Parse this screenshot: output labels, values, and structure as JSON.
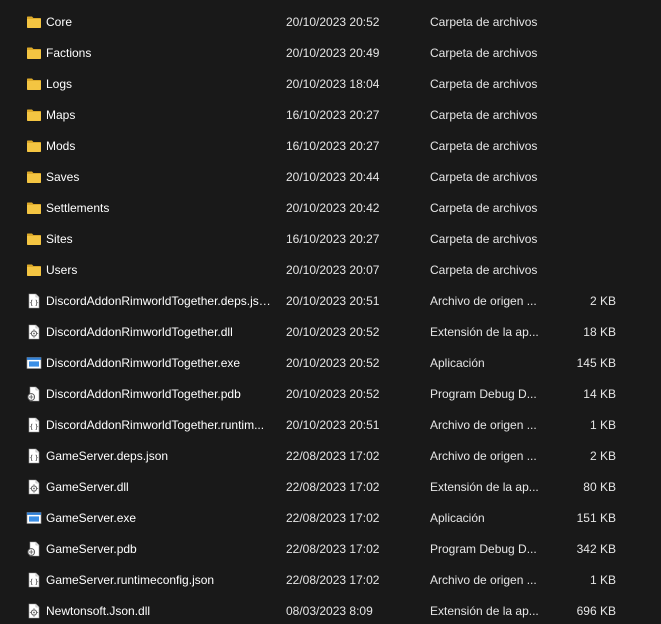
{
  "files": [
    {
      "name": "Core",
      "date": "20/10/2023 20:52",
      "type": "Carpeta de archivos",
      "size": "",
      "icon": "folder-icon"
    },
    {
      "name": "Factions",
      "date": "20/10/2023 20:49",
      "type": "Carpeta de archivos",
      "size": "",
      "icon": "folder-icon"
    },
    {
      "name": "Logs",
      "date": "20/10/2023 18:04",
      "type": "Carpeta de archivos",
      "size": "",
      "icon": "folder-icon"
    },
    {
      "name": "Maps",
      "date": "16/10/2023 20:27",
      "type": "Carpeta de archivos",
      "size": "",
      "icon": "folder-icon"
    },
    {
      "name": "Mods",
      "date": "16/10/2023 20:27",
      "type": "Carpeta de archivos",
      "size": "",
      "icon": "folder-icon"
    },
    {
      "name": "Saves",
      "date": "20/10/2023 20:44",
      "type": "Carpeta de archivos",
      "size": "",
      "icon": "folder-icon"
    },
    {
      "name": "Settlements",
      "date": "20/10/2023 20:42",
      "type": "Carpeta de archivos",
      "size": "",
      "icon": "folder-icon"
    },
    {
      "name": "Sites",
      "date": "16/10/2023 20:27",
      "type": "Carpeta de archivos",
      "size": "",
      "icon": "folder-icon"
    },
    {
      "name": "Users",
      "date": "20/10/2023 20:07",
      "type": "Carpeta de archivos",
      "size": "",
      "icon": "folder-icon"
    },
    {
      "name": "DiscordAddonRimworldTogether.deps.json",
      "date": "20/10/2023 20:51",
      "type": "Archivo de origen ...",
      "size": "2 KB",
      "icon": "json-file-icon"
    },
    {
      "name": "DiscordAddonRimworldTogether.dll",
      "date": "20/10/2023 20:52",
      "type": "Extensión de la ap...",
      "size": "18 KB",
      "icon": "dll-file-icon"
    },
    {
      "name": "DiscordAddonRimworldTogether.exe",
      "date": "20/10/2023 20:52",
      "type": "Aplicación",
      "size": "145 KB",
      "icon": "exe-file-icon"
    },
    {
      "name": "DiscordAddonRimworldTogether.pdb",
      "date": "20/10/2023 20:52",
      "type": "Program Debug D...",
      "size": "14 KB",
      "icon": "pdb-file-icon"
    },
    {
      "name": "DiscordAddonRimworldTogether.runtim...",
      "date": "20/10/2023 20:51",
      "type": "Archivo de origen ...",
      "size": "1 KB",
      "icon": "json-file-icon"
    },
    {
      "name": "GameServer.deps.json",
      "date": "22/08/2023 17:02",
      "type": "Archivo de origen ...",
      "size": "2 KB",
      "icon": "json-file-icon"
    },
    {
      "name": "GameServer.dll",
      "date": "22/08/2023 17:02",
      "type": "Extensión de la ap...",
      "size": "80 KB",
      "icon": "dll-file-icon"
    },
    {
      "name": "GameServer.exe",
      "date": "22/08/2023 17:02",
      "type": "Aplicación",
      "size": "151 KB",
      "icon": "exe-file-icon"
    },
    {
      "name": "GameServer.pdb",
      "date": "22/08/2023 17:02",
      "type": "Program Debug D...",
      "size": "342 KB",
      "icon": "pdb-file-icon"
    },
    {
      "name": "GameServer.runtimeconfig.json",
      "date": "22/08/2023 17:02",
      "type": "Archivo de origen ...",
      "size": "1 KB",
      "icon": "json-file-icon"
    },
    {
      "name": "Newtonsoft.Json.dll",
      "date": "08/03/2023 8:09",
      "type": "Extensión de la ap...",
      "size": "696 KB",
      "icon": "dll-file-icon"
    }
  ],
  "colors": {
    "background": "#191919",
    "folder": "#f4c542",
    "folder_dark": "#dca92a",
    "exe_blue": "#2f7fd6"
  }
}
